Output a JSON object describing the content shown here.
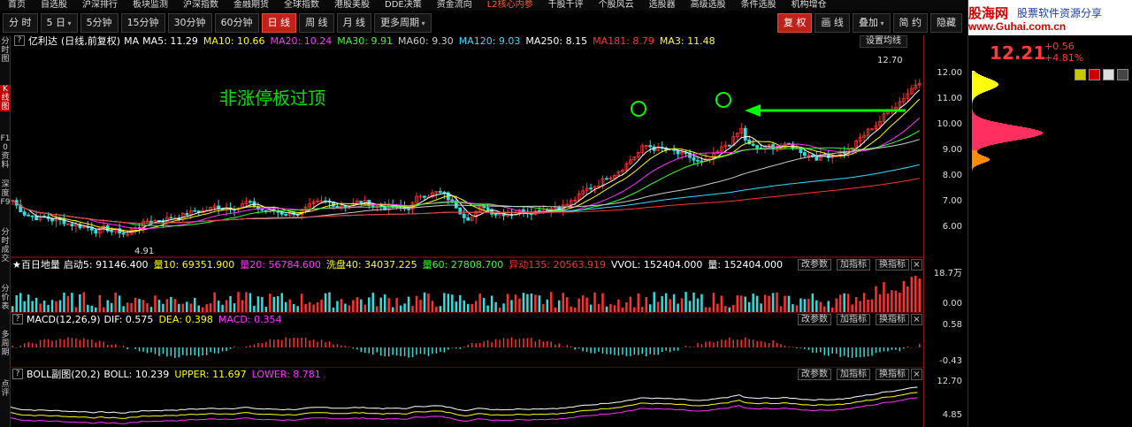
{
  "top_menu": [
    "首页",
    "自选股",
    "沪深排行",
    "板块监测",
    "沪深指数",
    "金融期货",
    "全球指数",
    "港股美股",
    "DDE决策",
    "资金流向",
    "L2核心内参",
    "千股千评",
    "个股风云",
    "选股器",
    "高级选股",
    "条件选股",
    "机构增仓"
  ],
  "toolbar_left": [
    "分 时",
    "5 日",
    "5分钟",
    "15分钟",
    "30分钟",
    "60分钟",
    "日 线",
    "周 线",
    "月 线",
    "更多周期"
  ],
  "toolbar_right": [
    "复 权",
    "画 线",
    "叠加",
    "简 约",
    "隐藏"
  ],
  "left_tabs": [
    "分时图",
    "K线图",
    "F10资料",
    "深度F9",
    "分时成交",
    "分价表",
    "多周期",
    "点评"
  ],
  "stock_name": "亿利达",
  "main_legend": {
    "title": "(日线,前复权)",
    "ma_label": "MA",
    "items": [
      {
        "text": "MA5: 11.29",
        "color": "#ffffff"
      },
      {
        "text": "MA10: 10.66",
        "color": "#ffff00"
      },
      {
        "text": "MA20: 10.24",
        "color": "#ff33ff"
      },
      {
        "text": "MA30: 9.91",
        "color": "#33ff33"
      },
      {
        "text": "MA60: 9.30",
        "color": "#cccccc"
      },
      {
        "text": "MA120: 9.03",
        "color": "#33ddff"
      },
      {
        "text": "MA250: 8.15",
        "color": "#ffffff"
      },
      {
        "text": "MA181: 8.79",
        "color": "#ff3333"
      },
      {
        "text": "MA3: 11.48",
        "color": "#ffff33"
      }
    ],
    "settings_button": "设置均线"
  },
  "annotation": "非涨停板过顶",
  "high_label": "12.70",
  "low_label": "4.91",
  "main_yaxis": [
    "12.00",
    "11.00",
    "10.00",
    "9.00",
    "8.00",
    "7.00",
    "6.00"
  ],
  "volume_panel": {
    "title": "★百日地量",
    "items": [
      {
        "text": "启动5: 91146.400",
        "color": "#ffffff"
      },
      {
        "text": "量10: 69351.900",
        "color": "#ffff00"
      },
      {
        "text": "量20: 56784.600",
        "color": "#ff33ff"
      },
      {
        "text": "洗盘40: 34037.225",
        "color": "#ffff00"
      },
      {
        "text": "量60: 27808.700",
        "color": "#33ff33"
      },
      {
        "text": "异动135: 20563.919",
        "color": "#ff3333"
      },
      {
        "text": "VVOL: 152404.000",
        "color": "#ffffff"
      },
      {
        "text": "量: 152404.000",
        "color": "#ffffff"
      }
    ],
    "yaxis": [
      "18.7万",
      "0.00"
    ]
  },
  "macd_panel": {
    "title": "MACD(12,26,9)",
    "items": [
      {
        "text": "DIF: 0.575",
        "color": "#ffffff"
      },
      {
        "text": "DEA: 0.398",
        "color": "#ffff00"
      },
      {
        "text": "MACD: 0.354",
        "color": "#ff33ff"
      }
    ],
    "yaxis": [
      "0.58",
      "-0.43"
    ]
  },
  "boll_panel": {
    "title": "BOLL副图(20,2)",
    "items": [
      {
        "text": "BOLL: 10.239",
        "color": "#ffffff"
      },
      {
        "text": "UPPER: 11.697",
        "color": "#ffff00"
      },
      {
        "text": "LOWER: 8.781",
        "color": "#ff33ff"
      }
    ],
    "yaxis": [
      "12.70",
      "4.85"
    ]
  },
  "panel_buttons": [
    "改参数",
    "加指标",
    "换指标",
    "×"
  ],
  "side": {
    "brand_cn": "股海网",
    "brand_slogan": "股票软件资源分享",
    "brand_url": "www.Guhai.com.cn",
    "price": "12.21",
    "change": "+0.56",
    "change_pct": "+4.81%"
  }
}
